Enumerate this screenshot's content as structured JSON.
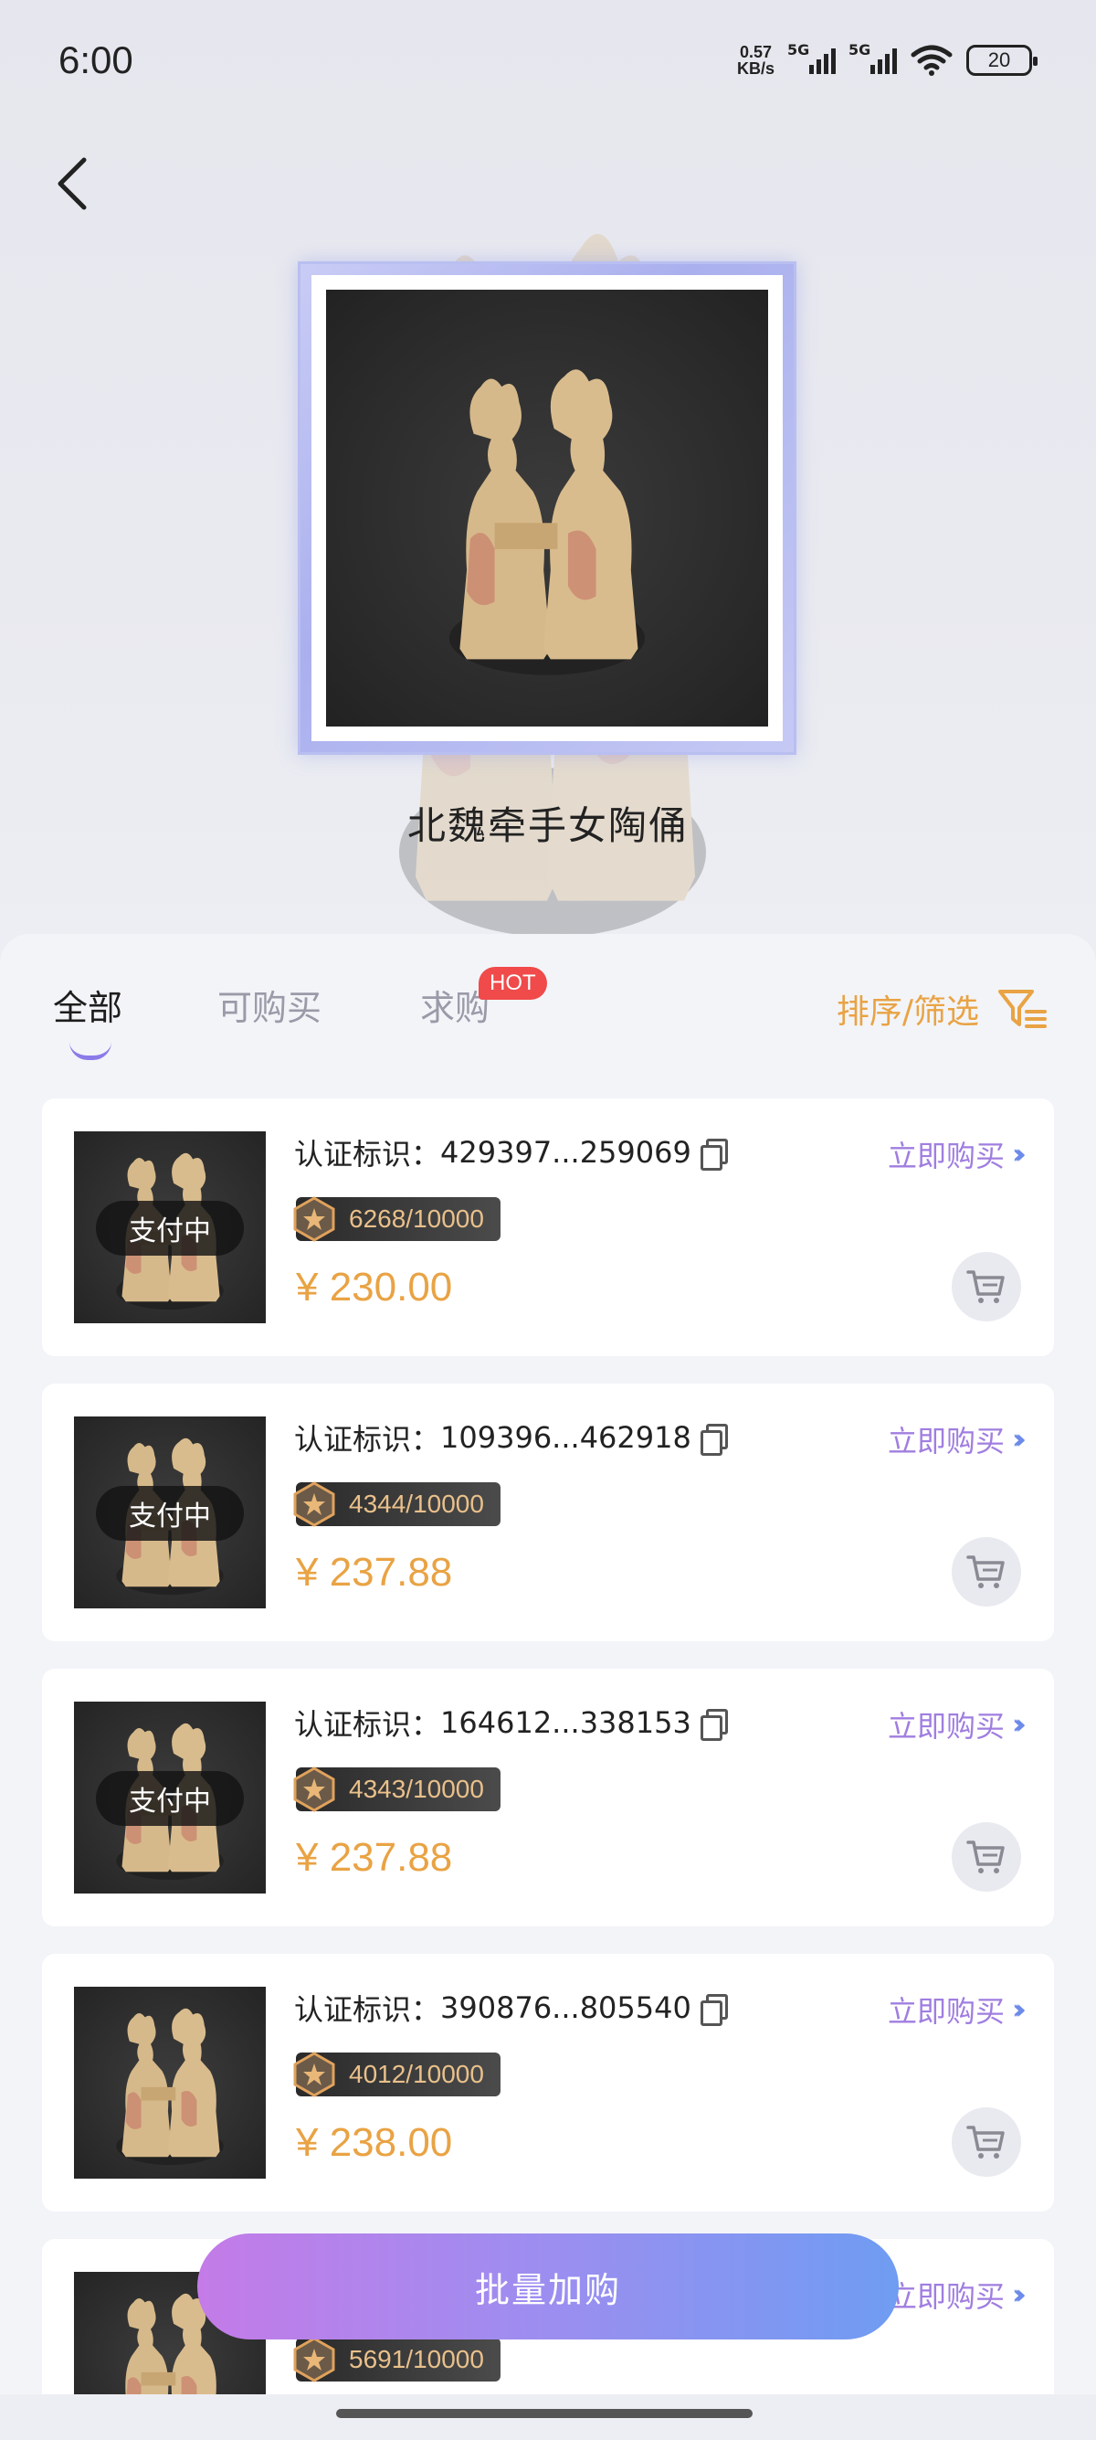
{
  "status_bar": {
    "time": "6:00",
    "speed_value": "0.57",
    "speed_unit": "KB/s",
    "network_1": "5G",
    "network_2": "5G",
    "battery": "20"
  },
  "product": {
    "title": "北魏牵手女陶俑"
  },
  "tabs": [
    {
      "label": "全部",
      "active": true
    },
    {
      "label": "可购买",
      "active": false
    },
    {
      "label": "求购",
      "active": false,
      "badge": "HOT"
    }
  ],
  "sort_filter_label": "排序/筛选",
  "listings": [
    {
      "cert_label": "认证标识：",
      "cert_id": "429397...259069",
      "buy_label": "立即购买",
      "edition": "6268/10000",
      "price": "¥ 230.00",
      "status": "支付中"
    },
    {
      "cert_label": "认证标识：",
      "cert_id": "109396...462918",
      "buy_label": "立即购买",
      "edition": "4344/10000",
      "price": "¥ 237.88",
      "status": "支付中"
    },
    {
      "cert_label": "认证标识：",
      "cert_id": "164612...338153",
      "buy_label": "立即购买",
      "edition": "4343/10000",
      "price": "¥ 237.88",
      "status": "支付中"
    },
    {
      "cert_label": "认证标识：",
      "cert_id": "390876...805540",
      "buy_label": "立即购买",
      "edition": "4012/10000",
      "price": "¥ 238.00",
      "status": ""
    },
    {
      "cert_label": "",
      "cert_id": "",
      "buy_label": "立即购买",
      "edition": "5691/10000",
      "price": "",
      "status": ""
    }
  ],
  "batch_button_label": "批量加购",
  "colors": {
    "accent_orange": "#e9a344",
    "accent_purple": "#a07ee0",
    "hot_red": "#f04a4a",
    "gradient_start": "#c47be8",
    "gradient_end": "#6f9cf2"
  }
}
